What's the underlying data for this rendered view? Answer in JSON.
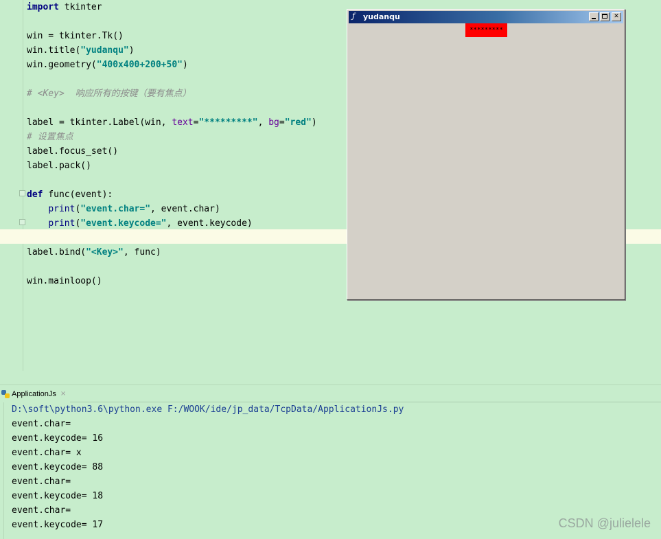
{
  "editor": {
    "lines": [
      [
        {
          "t": "import",
          "c": "kw"
        },
        {
          "t": " tkinter",
          "c": ""
        }
      ],
      [],
      [
        {
          "t": "win = tkinter.Tk()",
          "c": ""
        }
      ],
      [
        {
          "t": "win.title(",
          "c": ""
        },
        {
          "t": "\"yudanqu\"",
          "c": "str"
        },
        {
          "t": ")",
          "c": ""
        }
      ],
      [
        {
          "t": "win.geometry(",
          "c": ""
        },
        {
          "t": "\"400x400+200+50\"",
          "c": "str"
        },
        {
          "t": ")",
          "c": ""
        }
      ],
      [],
      [
        {
          "t": "# <Key>  响应所有的按键（要有焦点）",
          "c": "cm"
        }
      ],
      [],
      [
        {
          "t": "label = tkinter.Label(win, ",
          "c": ""
        },
        {
          "t": "text",
          "c": "prm"
        },
        {
          "t": "=",
          "c": ""
        },
        {
          "t": "\"*********\"",
          "c": "str"
        },
        {
          "t": ", ",
          "c": ""
        },
        {
          "t": "bg",
          "c": "prm"
        },
        {
          "t": "=",
          "c": ""
        },
        {
          "t": "\"red\"",
          "c": "str"
        },
        {
          "t": ")",
          "c": ""
        }
      ],
      [
        {
          "t": "# 设置焦点",
          "c": "cm"
        }
      ],
      [
        {
          "t": "label.focus_set()",
          "c": ""
        }
      ],
      [
        {
          "t": "label.pack()",
          "c": ""
        }
      ],
      [],
      [
        {
          "t": "def",
          "c": "kw"
        },
        {
          "t": " func(event):",
          "c": ""
        }
      ],
      [
        {
          "t": "    ",
          "c": ""
        },
        {
          "t": "print",
          "c": "bi"
        },
        {
          "t": "(",
          "c": ""
        },
        {
          "t": "\"event.char=\"",
          "c": "str"
        },
        {
          "t": ", event.char)",
          "c": ""
        }
      ],
      [
        {
          "t": "    ",
          "c": ""
        },
        {
          "t": "print",
          "c": "bi"
        },
        {
          "t": "(",
          "c": ""
        },
        {
          "t": "\"event.keycode=\"",
          "c": "str"
        },
        {
          "t": ", event.keycode)",
          "c": ""
        }
      ],
      [],
      [
        {
          "t": "label.bind(",
          "c": ""
        },
        {
          "t": "\"<Key>\"",
          "c": "str"
        },
        {
          "t": ", func)",
          "c": ""
        }
      ],
      [],
      [
        {
          "t": "win.mainloop()",
          "c": ""
        }
      ]
    ]
  },
  "tk_window": {
    "title": "yudanqu",
    "icon": "feather-icon",
    "label_text": "*********",
    "label_bg": "#ff0000",
    "buttons": {
      "close": "✕"
    }
  },
  "run_panel": {
    "tab_label": "ApplicationJs",
    "tab_close": "×",
    "command": "D:\\soft\\python3.6\\python.exe F:/WOOK/ide/jp_data/TcpData/ApplicationJs.py",
    "output": [
      "event.char= ",
      "event.keycode= 16",
      "event.char= x",
      "event.keycode= 88",
      "event.char= ",
      "event.keycode= 18",
      "event.char= ",
      "event.keycode= 17"
    ]
  },
  "watermark": "CSDN @julielele"
}
